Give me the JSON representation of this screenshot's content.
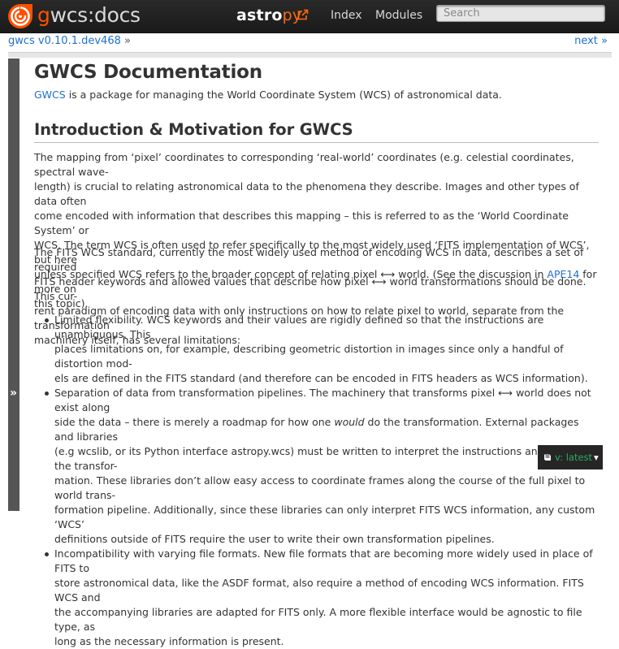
{
  "navbar": {
    "brand_accent": "g",
    "brand_rest": "wcs:docs",
    "astro_text": "astro",
    "astro_py": "py",
    "links": [
      "Index",
      "Modules"
    ],
    "search_placeholder": "Search",
    "colors": {
      "bar": "#1f1f1f",
      "accent": "#ff5000"
    }
  },
  "breadcrumb": {
    "version_link": "gwcs v0.10.1.dev468",
    "separator": "»",
    "next_link": "next »"
  },
  "sidebar": {
    "toggle_glyph": "»"
  },
  "page": {
    "title": "GWCS Documentation",
    "intro_link": "GWCS",
    "intro_text": " is a package for managing the World Coordinate System (WCS) of astronomical data.",
    "section_title": "Introduction & Motivation for GWCS",
    "p1_lines": [
      "The mapping from ‘pixel’ coordinates to corresponding ‘real-world’ coordinates (e.g. celestial coordinates, spectral wave-",
      "length) is crucial to relating astronomical data to the phenomena they describe. Images and other types of data often",
      "come encoded with information that describes this mapping – this is referred to as the ‘World Coordinate System’ or",
      "WCS. The term WCS is often used to refer specifically to the most widely used ‘FITS implementation of WCS’, but here"
    ],
    "p1_l5_pre": "unless specified WCS refers to the broader concept of relating pixel ⟷ world. (See the discussion in ",
    "p1_l5_link": "APE14",
    "p1_l5_post": " for more on",
    "p1_l6": "this topic).",
    "p2_lines": [
      "The FITS WCS standard, currently the most widely used method of encoding WCS in data, describes a set of required",
      "FITS header keywords and allowed values that describe how pixel ⟷ world transformations should be done. This cur-",
      "rent paradigm of encoding data with only instructions on how to relate pixel to world, separate from the transformation",
      "machinery itself, has several limitations:"
    ],
    "b1_lines": [
      "Limited flexibility. WCS keywords and their values are rigidly defined so that the instructions are unambiguous. This",
      "places limitations on, for example, describing geometric distortion in images since only a handful of distortion mod-",
      "els are defined in the FITS standard (and therefore can be encoded in FITS headers as WCS information)."
    ],
    "b2_l1": "Separation of data from transformation pipelines. The machinery that transforms pixel ⟷ world does not exist along",
    "b2_l2_pre": "side the data – there is merely a roadmap for how one ",
    "b2_l2_em": "would",
    "b2_l2_post": " do the transformation. External packages and libraries",
    "b2_rest": [
      "(e.g wcslib, or its Python interface astropy.wcs) must be written to interpret the instructions and execute the transfor-",
      "mation. These libraries don’t allow easy access to coordinate frames along the course of the full pixel to world trans-",
      "formation pipeline. Additionally, since these libraries can only interpret FITS WCS information, any custom ‘WCS’",
      "definitions outside of FITS require the user to write their own transformation pipelines."
    ],
    "b3_lines": [
      "Incompatibility with varying file formats. New file formats that are becoming more widely used in place of FITS to",
      "store astronomical data, like the ASDF format, also require a method of encoding WCS information. FITS WCS and",
      "the accompanying libraries are adapted for FITS only. A more flexible interface would be agnostic to file type, as",
      "long as the necessary information is present."
    ]
  },
  "rtd_badge": {
    "label": "v: latest",
    "caret": "▾",
    "icon": "book-icon"
  }
}
